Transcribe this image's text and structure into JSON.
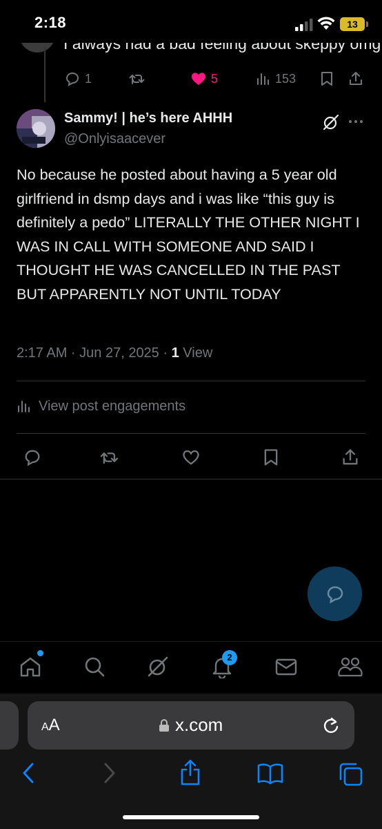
{
  "status_bar": {
    "time": "2:18",
    "battery": "13"
  },
  "previous_tweet": {
    "text": "I always had a bad feeling about skeppy omg",
    "replies": "1",
    "likes": "5",
    "views": "153"
  },
  "tweet": {
    "display_name": "Sammy! | he’s here AHHH",
    "handle": "@Onlyisaacever",
    "body": "No because he posted about having a 5 year old girlfriend in dsmp days and i was like “this guy is definitely a pedo” LITERALLY THE OTHER NIGHT I WAS IN CALL WITH SOMEONE AND SAID I THOUGHT HE WAS CANCELLED IN THE PAST BUT APPARENTLY NOT UNTIL TODAY",
    "time": "2:17 AM · Jun 27, 2025 · ",
    "view_count": "1",
    "view_label": " View",
    "engagements_label": "View post engagements"
  },
  "tab_bar": {
    "notification_count": "2"
  },
  "safari": {
    "aa_label": "A",
    "aa_label_big": "A",
    "url": "x.com"
  },
  "colors": {
    "accent": "#1d9bf0",
    "like": "#f91880",
    "muted": "#71767b",
    "text": "#e7e9ea",
    "battery": "#d9bb2a"
  }
}
